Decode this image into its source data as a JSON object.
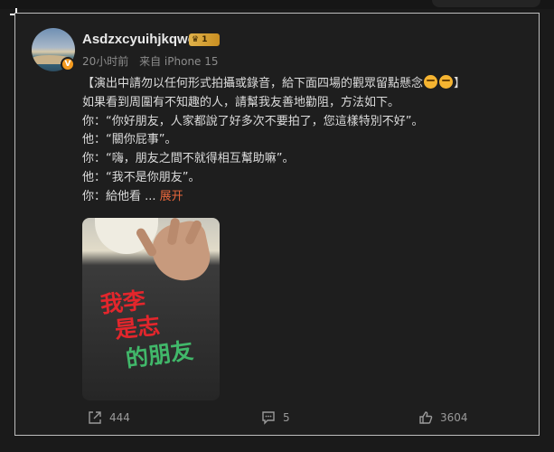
{
  "post": {
    "username": "Asdzxcyuihjkqwe",
    "level_badge": "1",
    "verified_mark": "V",
    "time": "20小时前",
    "source": "来自 iPhone 15",
    "lines": [
      "【演出中請勿以任何形式拍攝或錄音，給下面四場的觀眾留點懸念",
      "如果看到周圍有不知趣的人，請幫我友善地勸阻，方法如下。",
      "你：“你好朋友，人家都說了好多次不要拍了，您這樣特別不好”。",
      "他：“關你屁事”。",
      "你：“嗨，朋友之間不就得相互幫助嘛”。",
      "他：“我不是你朋友”。",
      "你：給他看 ..."
    ],
    "line1_close": "】",
    "expand_label": "展开",
    "image_text": {
      "row1": "我李",
      "row2": "是志",
      "row3": "的朋友"
    }
  },
  "actions": {
    "share_count": "444",
    "comment_count": "5",
    "like_count": "3604"
  },
  "colors": {
    "accent": "#e8673c",
    "verified": "#f39a1f",
    "shirt_red": "#e3262c",
    "shirt_green": "#41b86a"
  },
  "icons": [
    "share-icon",
    "comment-icon",
    "like-icon",
    "crown-icon"
  ]
}
